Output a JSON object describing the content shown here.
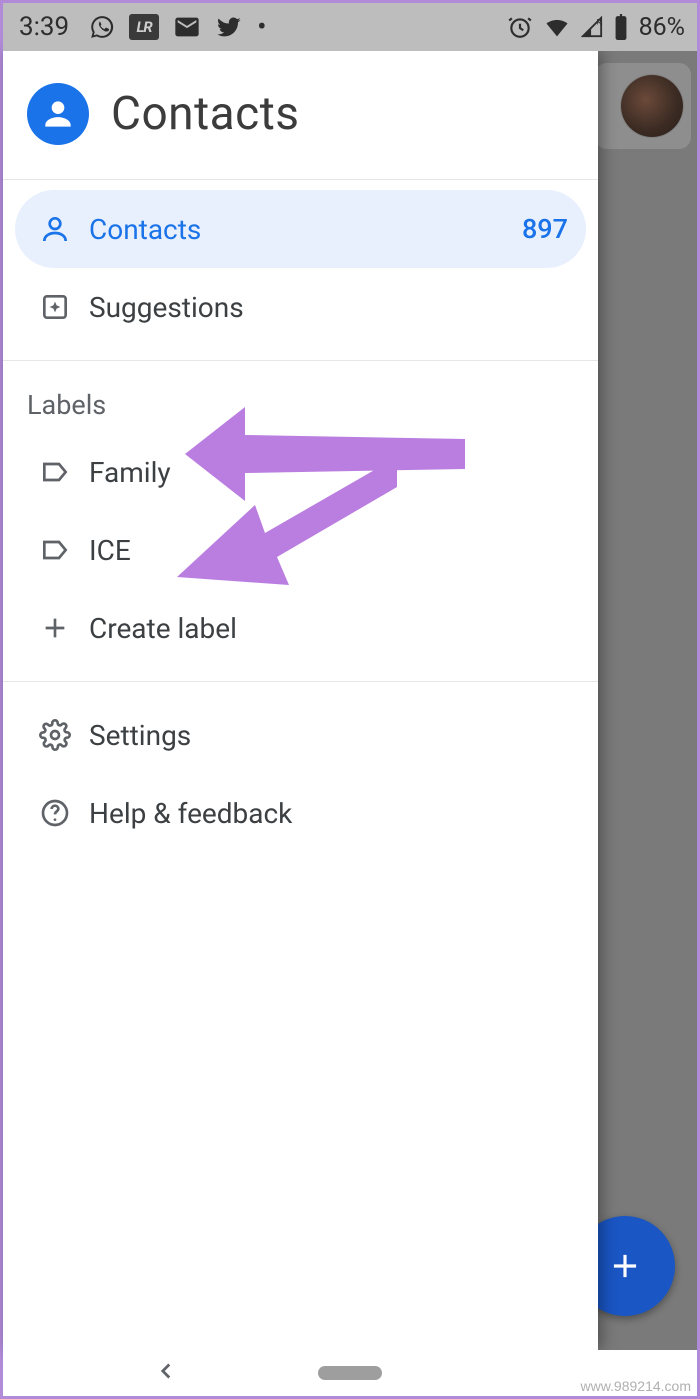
{
  "statusbar": {
    "time": "3:39",
    "battery_text": "86%"
  },
  "drawer": {
    "app_title": "Contacts",
    "contacts": {
      "label": "Contacts",
      "count": "897"
    },
    "suggestions": {
      "label": "Suggestions"
    },
    "labels_header": "Labels",
    "labels": [
      {
        "name": "Family"
      },
      {
        "name": "ICE"
      }
    ],
    "create_label": "Create label",
    "settings": "Settings",
    "help": "Help & feedback"
  },
  "watermark": "www.989214.com"
}
